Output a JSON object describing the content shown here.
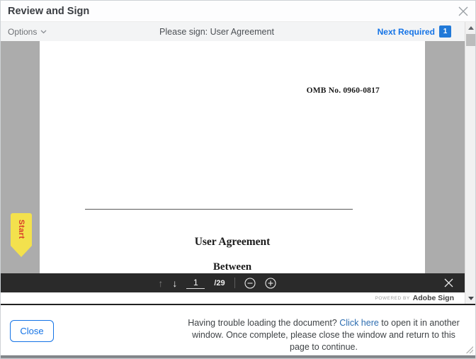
{
  "window": {
    "title": "Review and Sign"
  },
  "subbar": {
    "options_label": "Options",
    "center_message": "Please sign: User Agreement",
    "next_required_label": "Next Required",
    "next_required_count": "1"
  },
  "document": {
    "omb_number": "OMB No. 0960-0817",
    "title": "User Agreement",
    "subtitle": "Between",
    "start_tag_label": "Start"
  },
  "pdf_toolbar": {
    "page_number": "1",
    "page_total": "/29"
  },
  "branding": {
    "powered_by": "POWERED BY",
    "brand": "Adobe Sign"
  },
  "footer": {
    "close_button": "Close",
    "help_line1_pre": "Having trouble loading the document? ",
    "help_link": "Click here",
    "help_line1_post": " to open it in another window.",
    "help_line2": "Once complete, please close the window and return to this page to continue."
  },
  "icons": {
    "up_arrow": "↑",
    "down_arrow": "↓"
  },
  "colors": {
    "accent_blue": "#1473e6",
    "link_blue": "#2b6cb0",
    "badge_blue": "#2179d8",
    "viewer_gray": "#acacac",
    "pdf_toolbar_dark": "#2a2a2a",
    "start_tag_yellow": "#f3e14d",
    "start_tag_text_red": "#d93a2b"
  }
}
